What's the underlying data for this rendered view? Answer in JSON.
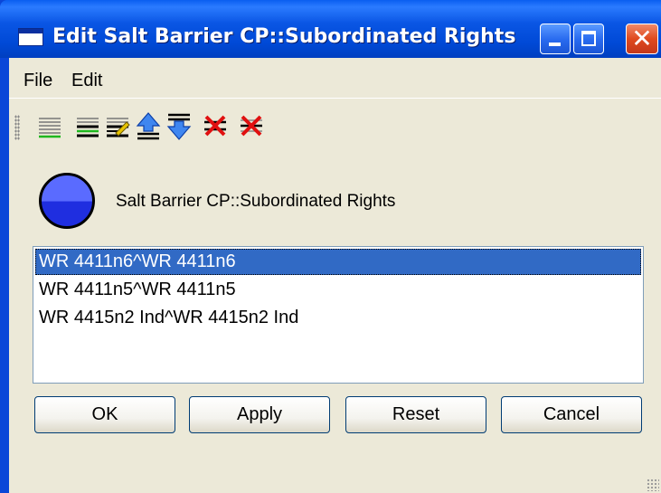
{
  "window": {
    "title": "Edit Salt Barrier CP::Subordinated Rights"
  },
  "menu": {
    "file": "File",
    "edit": "Edit"
  },
  "toolbar": {
    "tools": [
      "add-item-icon",
      "insert-item-icon",
      "edit-item-icon",
      "move-up-icon",
      "move-down-icon",
      "delete-icon",
      "clear-icon"
    ]
  },
  "status": {
    "label": "Salt Barrier CP::Subordinated Rights",
    "color": "#3344ee"
  },
  "list": {
    "items": [
      "WR 4411n6^WR 4411n6",
      "WR 4411n5^WR 4411n5",
      "WR 4415n2 Ind^WR 4415n2 Ind"
    ],
    "selected_index": 0
  },
  "buttons": {
    "ok": "OK",
    "apply": "Apply",
    "reset": "Reset",
    "cancel": "Cancel"
  },
  "colors": {
    "titlebar": "#0a56e4",
    "selection": "#316ac5",
    "client": "#ece9d8"
  }
}
